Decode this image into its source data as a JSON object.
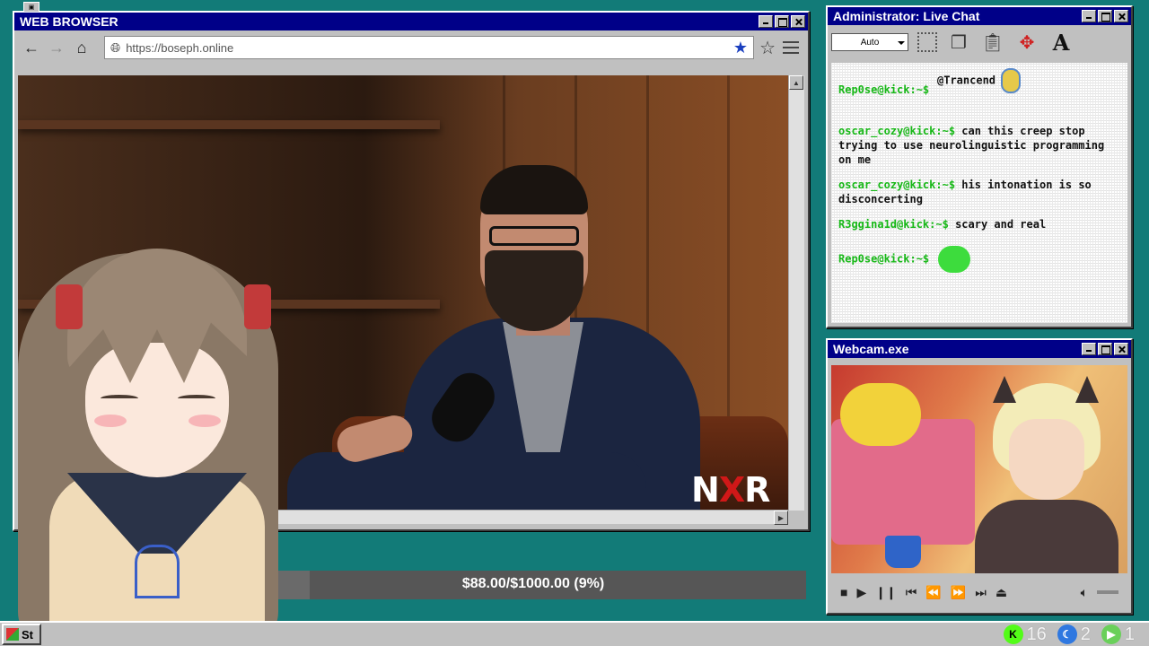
{
  "browser": {
    "title": "WEB BROWSER",
    "url": "https://boseph.online",
    "video_logo_prefix": "N",
    "video_logo_mid": "X",
    "video_logo_suffix": "R"
  },
  "chat": {
    "title": "Administrator: Live Chat",
    "font_size_option": "Auto",
    "messages": [
      {
        "user": "",
        "text": "@Trancend",
        "emote": "avatar"
      },
      {
        "user": "Rep0se@kick:~$",
        "text": "",
        "emote": ""
      },
      {
        "user": "oscar_cozy@kick:~$",
        "text": "can this creep stop trying to use neurolinguistic programming on me",
        "emote": ""
      },
      {
        "user": "oscar_cozy@kick:~$",
        "text": "his intonation is so disconcerting",
        "emote": ""
      },
      {
        "user": "R3ggina1d@kick:~$",
        "text": "scary and real",
        "emote": ""
      },
      {
        "user": "Rep0se@kick:~$",
        "text": "",
        "emote": "blob"
      }
    ]
  },
  "webcam": {
    "title": "Webcam.exe"
  },
  "donation": {
    "text": "$88.00/$1000.00 (9%)",
    "progress": 0.09
  },
  "taskbar": {
    "start_label": "St",
    "tray": [
      {
        "icon": "kick-icon",
        "count": "16",
        "color": "#53fc18"
      },
      {
        "icon": "moon-icon",
        "count": "2",
        "color": "#2f78e0"
      },
      {
        "icon": "play-icon",
        "count": "1",
        "color": "#6ad05a"
      }
    ]
  }
}
